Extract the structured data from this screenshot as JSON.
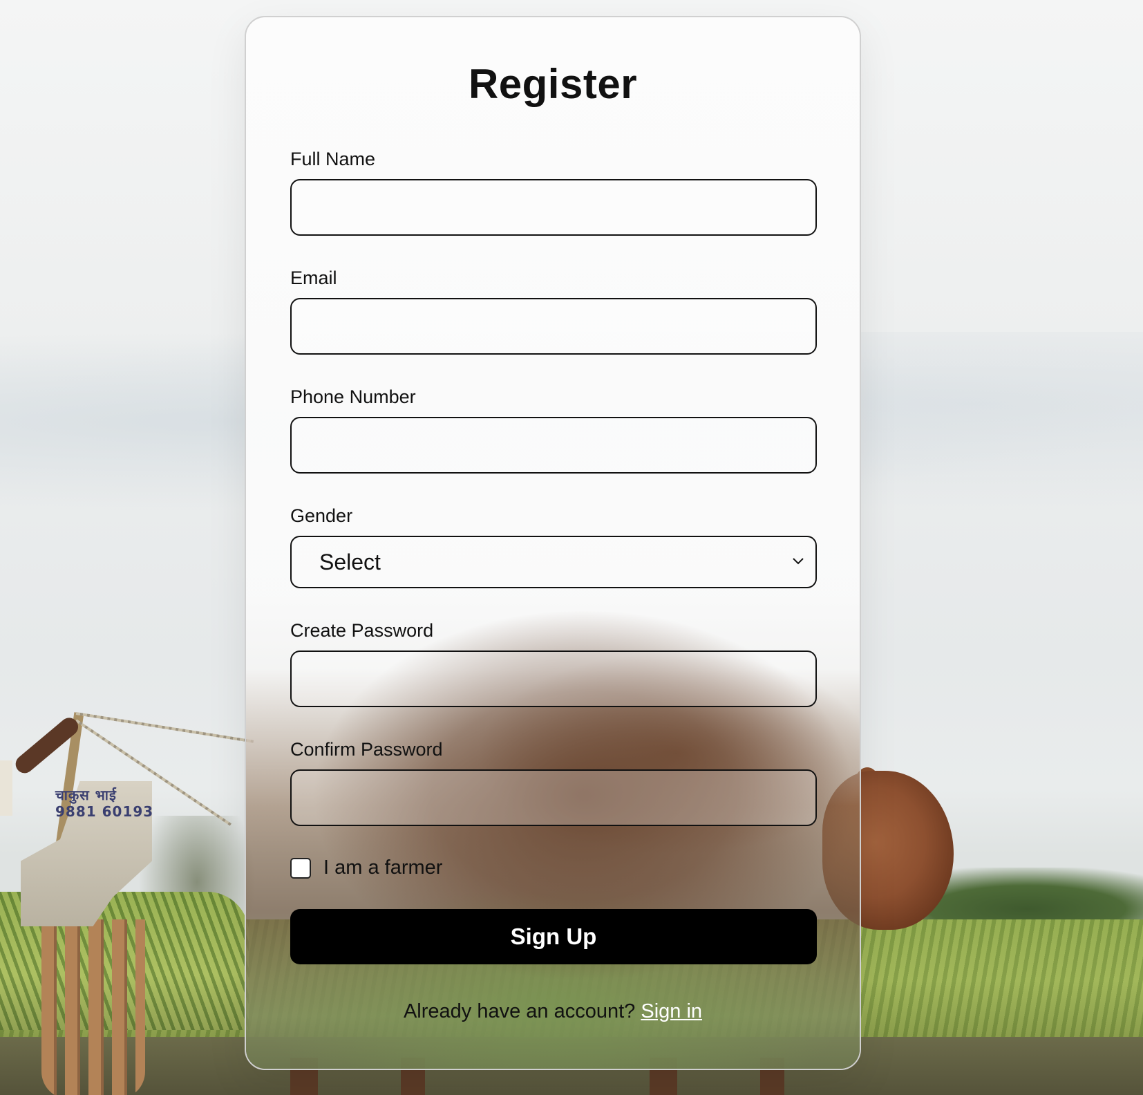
{
  "form": {
    "title": "Register",
    "fields": {
      "full_name": {
        "label": "Full Name",
        "value": ""
      },
      "email": {
        "label": "Email",
        "value": ""
      },
      "phone": {
        "label": "Phone Number",
        "value": ""
      },
      "gender": {
        "label": "Gender",
        "selected": "Select"
      },
      "password": {
        "label": "Create Password",
        "value": ""
      },
      "confirm_password": {
        "label": "Confirm Password",
        "value": ""
      }
    },
    "farmer_checkbox": {
      "label": "I am a farmer",
      "checked": false
    },
    "submit_label": "Sign Up",
    "footer": {
      "prompt": "Already have an account?",
      "link_label": "Sign in"
    }
  },
  "background": {
    "machine_label_line1": "चाकुस भाई",
    "machine_label_line2": "9881 60193"
  },
  "colors": {
    "button_bg": "#000000",
    "button_text": "#ffffff",
    "border": "#111111"
  }
}
